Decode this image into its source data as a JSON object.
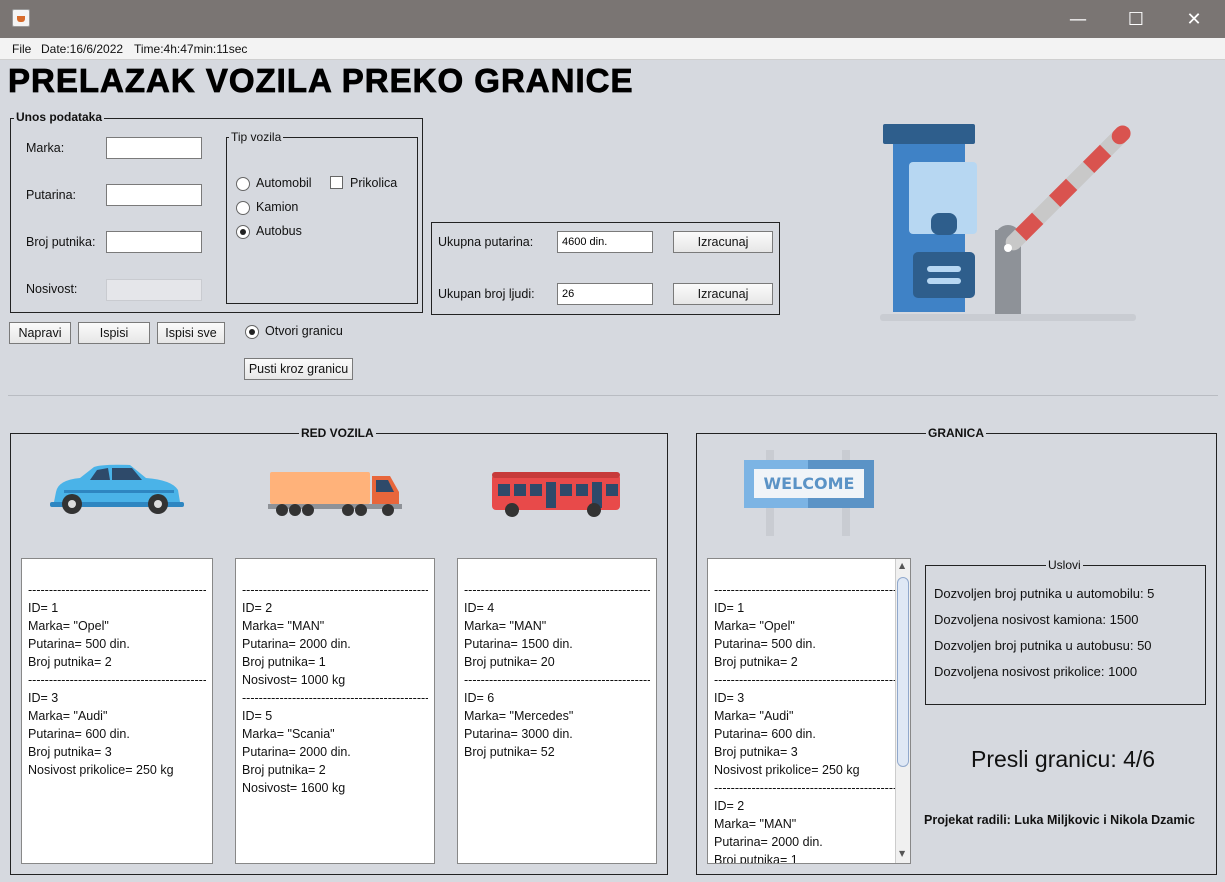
{
  "window": {
    "minimize": "—",
    "maximize": "☐",
    "close": "✕"
  },
  "menu": {
    "file": "File",
    "date": "Date:16/6/2022",
    "time": "Time:4h:47min:11sec"
  },
  "title": "PRELAZAK VOZILA PREKO GRANICE",
  "unos": {
    "legend": "Unos podataka",
    "marka_label": "Marka:",
    "putarina_label": "Putarina:",
    "broj_putnika_label": "Broj putnika:",
    "nosivost_label": "Nosivost:",
    "marka_value": "",
    "putarina_value": "",
    "broj_putnika_value": "",
    "nosivost_value": ""
  },
  "tip_vozila": {
    "legend": "Tip vozila",
    "automobil": "Automobil",
    "kamion": "Kamion",
    "autobus": "Autobus",
    "prikolica": "Prikolica",
    "selected": "Autobus"
  },
  "totals": {
    "ukupna_putarina_label": "Ukupna putarina:",
    "ukupna_putarina_value": "4600 din.",
    "ukupan_broj_label": "Ukupan broj ljudi:",
    "ukupan_broj_value": "26",
    "izracunaj": "Izracunaj"
  },
  "actions": {
    "napravi": "Napravi",
    "ispisi": "Ispisi",
    "ispisi_sve": "Ispisi sve",
    "otvori_granicu": "Otvori granicu",
    "pusti": "Pusti kroz granicu"
  },
  "red_vozila": {
    "legend": "RED VOZILA",
    "cars": [
      "",
      "ID= 1",
      "Marka= \"Opel\"",
      "Putarina= 500 din.",
      "Broj putnika= 2",
      "",
      "ID= 3",
      "Marka= \"Audi\"",
      "Putarina= 600 din.",
      "Broj putnika= 3",
      "Nosivost prikolice= 250 kg"
    ],
    "trucks": [
      "",
      "ID= 2",
      "Marka= \"MAN\"",
      "Putarina= 2000 din.",
      "Broj putnika= 1",
      "Nosivost= 1000 kg",
      "",
      "ID= 5",
      "Marka= \"Scania\"",
      "Putarina= 2000 din.",
      "Broj putnika= 2",
      "Nosivost= 1600 kg"
    ],
    "buses": [
      "",
      "ID= 4",
      "Marka= \"MAN\"",
      "Putarina= 1500 din.",
      "Broj putnika= 20",
      "",
      "ID= 6",
      "Marka= \"Mercedes\"",
      "Putarina= 3000 din.",
      "Broj putnika= 52"
    ]
  },
  "granica": {
    "legend": "GRANICA",
    "welcome": "WELCOME",
    "list": [
      "",
      "ID= 1",
      "Marka= \"Opel\"",
      "Putarina= 500 din.",
      "Broj putnika= 2",
      "",
      "ID= 3",
      "Marka= \"Audi\"",
      "Putarina= 600 din.",
      "Broj putnika= 3",
      "Nosivost prikolice= 250 kg",
      "",
      "ID= 2",
      "Marka= \"MAN\"",
      "Putarina= 2000 din.",
      "Broj putnika= 1"
    ],
    "uslovi_legend": "Uslovi",
    "uslovi": [
      "Dozvoljen broj putnika u automobilu: 5",
      "Dozvoljena nosivost kamiona: 1500",
      "Dozvoljen broj putnika u autobusu: 50",
      "Dozvoljena nosivost prikolice: 1000"
    ],
    "presli": "Presli granicu: 4/6",
    "credits": "Projekat radili: Luka Miljkovic i Nikola Dzamic"
  },
  "icons": [
    "app-icon",
    "toll-booth-icon",
    "car-icon",
    "truck-icon",
    "bus-icon",
    "welcome-sign-icon"
  ]
}
